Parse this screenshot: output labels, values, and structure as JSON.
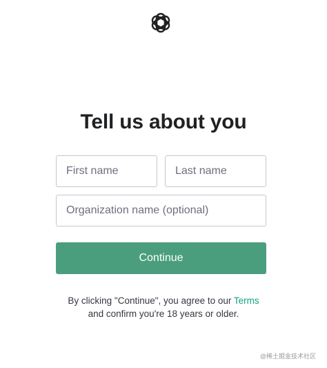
{
  "title": "Tell us about you",
  "form": {
    "first_name_placeholder": "First name",
    "last_name_placeholder": "Last name",
    "org_placeholder": "Organization name (optional)",
    "continue_label": "Continue"
  },
  "legal": {
    "prefix": "By clicking \"Continue\", you agree to our ",
    "terms_link": "Terms",
    "suffix": "and confirm you're 18 years or older."
  },
  "watermark": "@稀土掘金技术社区",
  "colors": {
    "accent": "#4a9e7e",
    "link": "#10a37f"
  },
  "icons": {
    "logo": "openai-logo-icon"
  }
}
